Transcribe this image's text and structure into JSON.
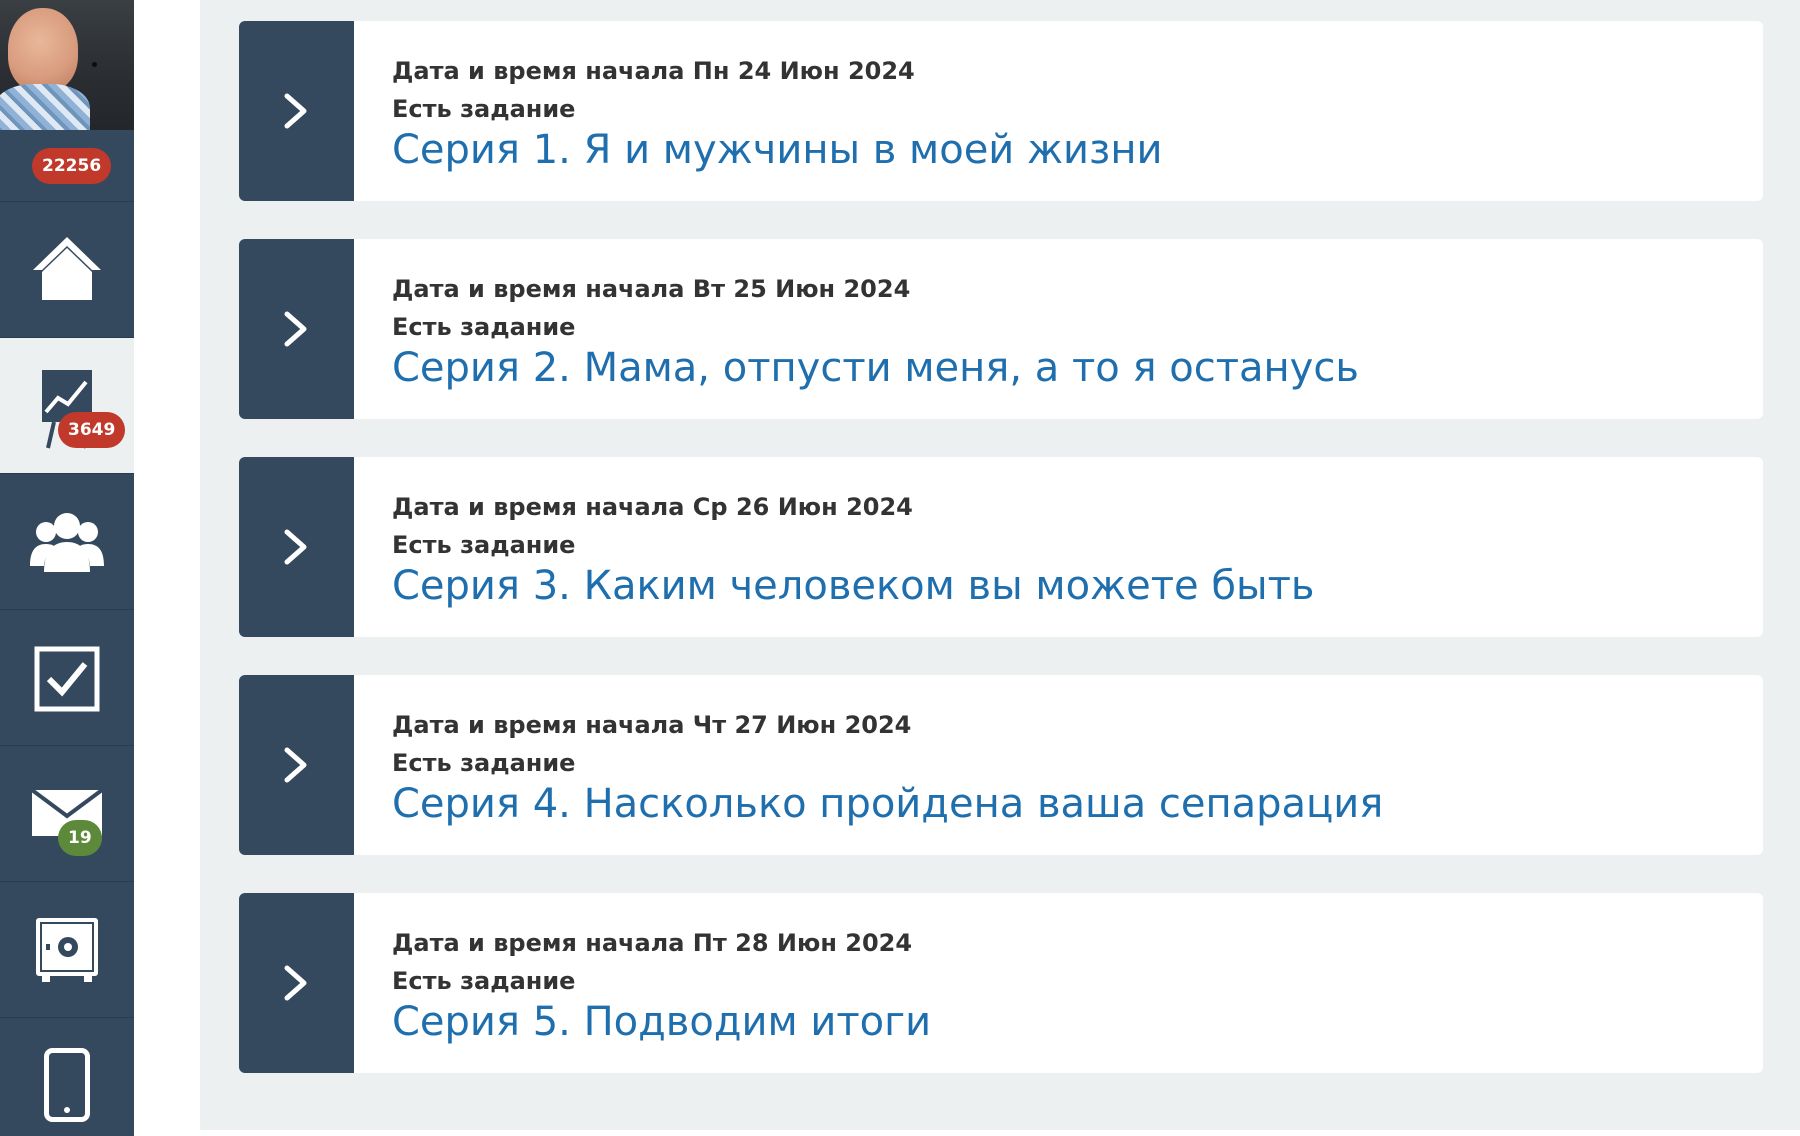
{
  "sidebar": {
    "notifications_count": "22256",
    "items": [
      {
        "name": "home",
        "icon": "home-icon",
        "badge": null
      },
      {
        "name": "stats",
        "icon": "chart-board-icon",
        "badge": "3649",
        "active": true
      },
      {
        "name": "groups",
        "icon": "users-icon",
        "badge": null
      },
      {
        "name": "tasks",
        "icon": "checkbox-icon",
        "badge": null
      },
      {
        "name": "messages",
        "icon": "mail-icon",
        "badge": "19"
      },
      {
        "name": "safe",
        "icon": "safe-icon",
        "badge": null
      },
      {
        "name": "mobile",
        "icon": "phone-icon",
        "badge": null
      }
    ]
  },
  "series": [
    {
      "date": "Дата и время начала Пн 24 Июн 2024",
      "task": "Есть задание",
      "title": "Серия 1. Я и мужчины в моей жизни"
    },
    {
      "date": "Дата и время начала Вт 25 Июн 2024",
      "task": "Есть задание",
      "title": "Серия 2. Мама, отпусти меня, а то я останусь"
    },
    {
      "date": "Дата и время начала Ср 26 Июн 2024",
      "task": "Есть задание",
      "title": "Серия 3. Каким человеком вы можете быть"
    },
    {
      "date": "Дата и время начала Чт 27 Июн 2024",
      "task": "Есть задание",
      "title": "Серия 4. Насколько пройдена ваша сепарация"
    },
    {
      "date": "Дата и время начала Пт 28 Июн 2024",
      "task": "Есть задание",
      "title": "Серия 5. Подводим итоги"
    }
  ],
  "colors": {
    "sidebar_bg": "#34495e",
    "main_bg": "#ecf0f1",
    "title_blue": "#1f6fae",
    "badge_red": "#c0392b",
    "badge_green": "#5c8a3a"
  }
}
